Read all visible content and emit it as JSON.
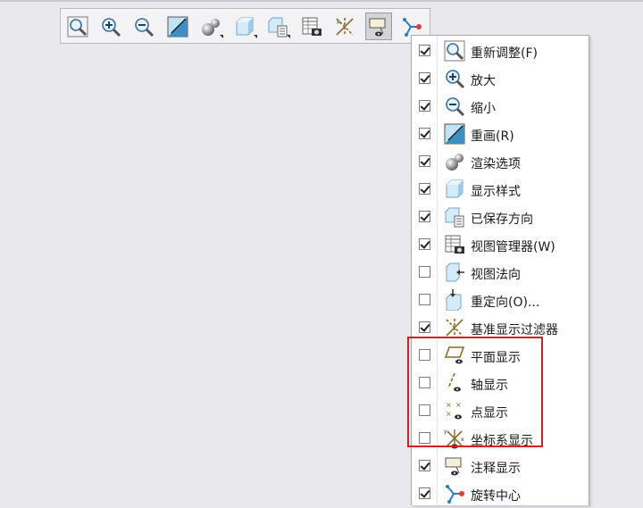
{
  "toolbar": {
    "buttons": [
      {
        "name": "refit-icon"
      },
      {
        "name": "zoom-in-icon"
      },
      {
        "name": "zoom-out-icon"
      },
      {
        "name": "repaint-icon"
      },
      {
        "name": "render-options-icon"
      },
      {
        "name": "display-style-icon"
      },
      {
        "name": "saved-orientations-icon"
      },
      {
        "name": "view-manager-icon"
      },
      {
        "name": "datum-filter-icon"
      },
      {
        "name": "annotation-display-icon"
      },
      {
        "name": "spin-center-icon"
      }
    ]
  },
  "menu": {
    "items": [
      {
        "label": "重新调整(F)",
        "checked": true,
        "icon": "refit-icon"
      },
      {
        "label": "放大",
        "checked": true,
        "icon": "zoom-in-icon"
      },
      {
        "label": "缩小",
        "checked": true,
        "icon": "zoom-out-icon"
      },
      {
        "label": "重画(R)",
        "checked": true,
        "icon": "repaint-icon"
      },
      {
        "label": "渲染选项",
        "checked": true,
        "icon": "render-options-icon"
      },
      {
        "label": "显示样式",
        "checked": true,
        "icon": "display-style-icon"
      },
      {
        "label": "已保存方向",
        "checked": true,
        "icon": "saved-orientations-icon"
      },
      {
        "label": "视图管理器(W)",
        "checked": true,
        "icon": "view-manager-icon"
      },
      {
        "label": "视图法向",
        "checked": false,
        "icon": "view-normal-icon"
      },
      {
        "label": "重定向(O)...",
        "checked": false,
        "icon": "reorient-icon"
      },
      {
        "label": "基准显示过滤器",
        "checked": true,
        "icon": "datum-filter-icon"
      },
      {
        "label": "平面显示",
        "checked": false,
        "icon": "plane-display-icon"
      },
      {
        "label": "轴显示",
        "checked": false,
        "icon": "axis-display-icon"
      },
      {
        "label": "点显示",
        "checked": false,
        "icon": "point-display-icon"
      },
      {
        "label": "坐标系显示",
        "checked": false,
        "icon": "csys-display-icon"
      },
      {
        "label": "注释显示",
        "checked": true,
        "icon": "annotation-display-icon"
      },
      {
        "label": "旋转中心",
        "checked": true,
        "icon": "spin-center-icon"
      }
    ]
  },
  "colors": {
    "highlight": "#d42020",
    "accent": "#2a7fc1"
  }
}
